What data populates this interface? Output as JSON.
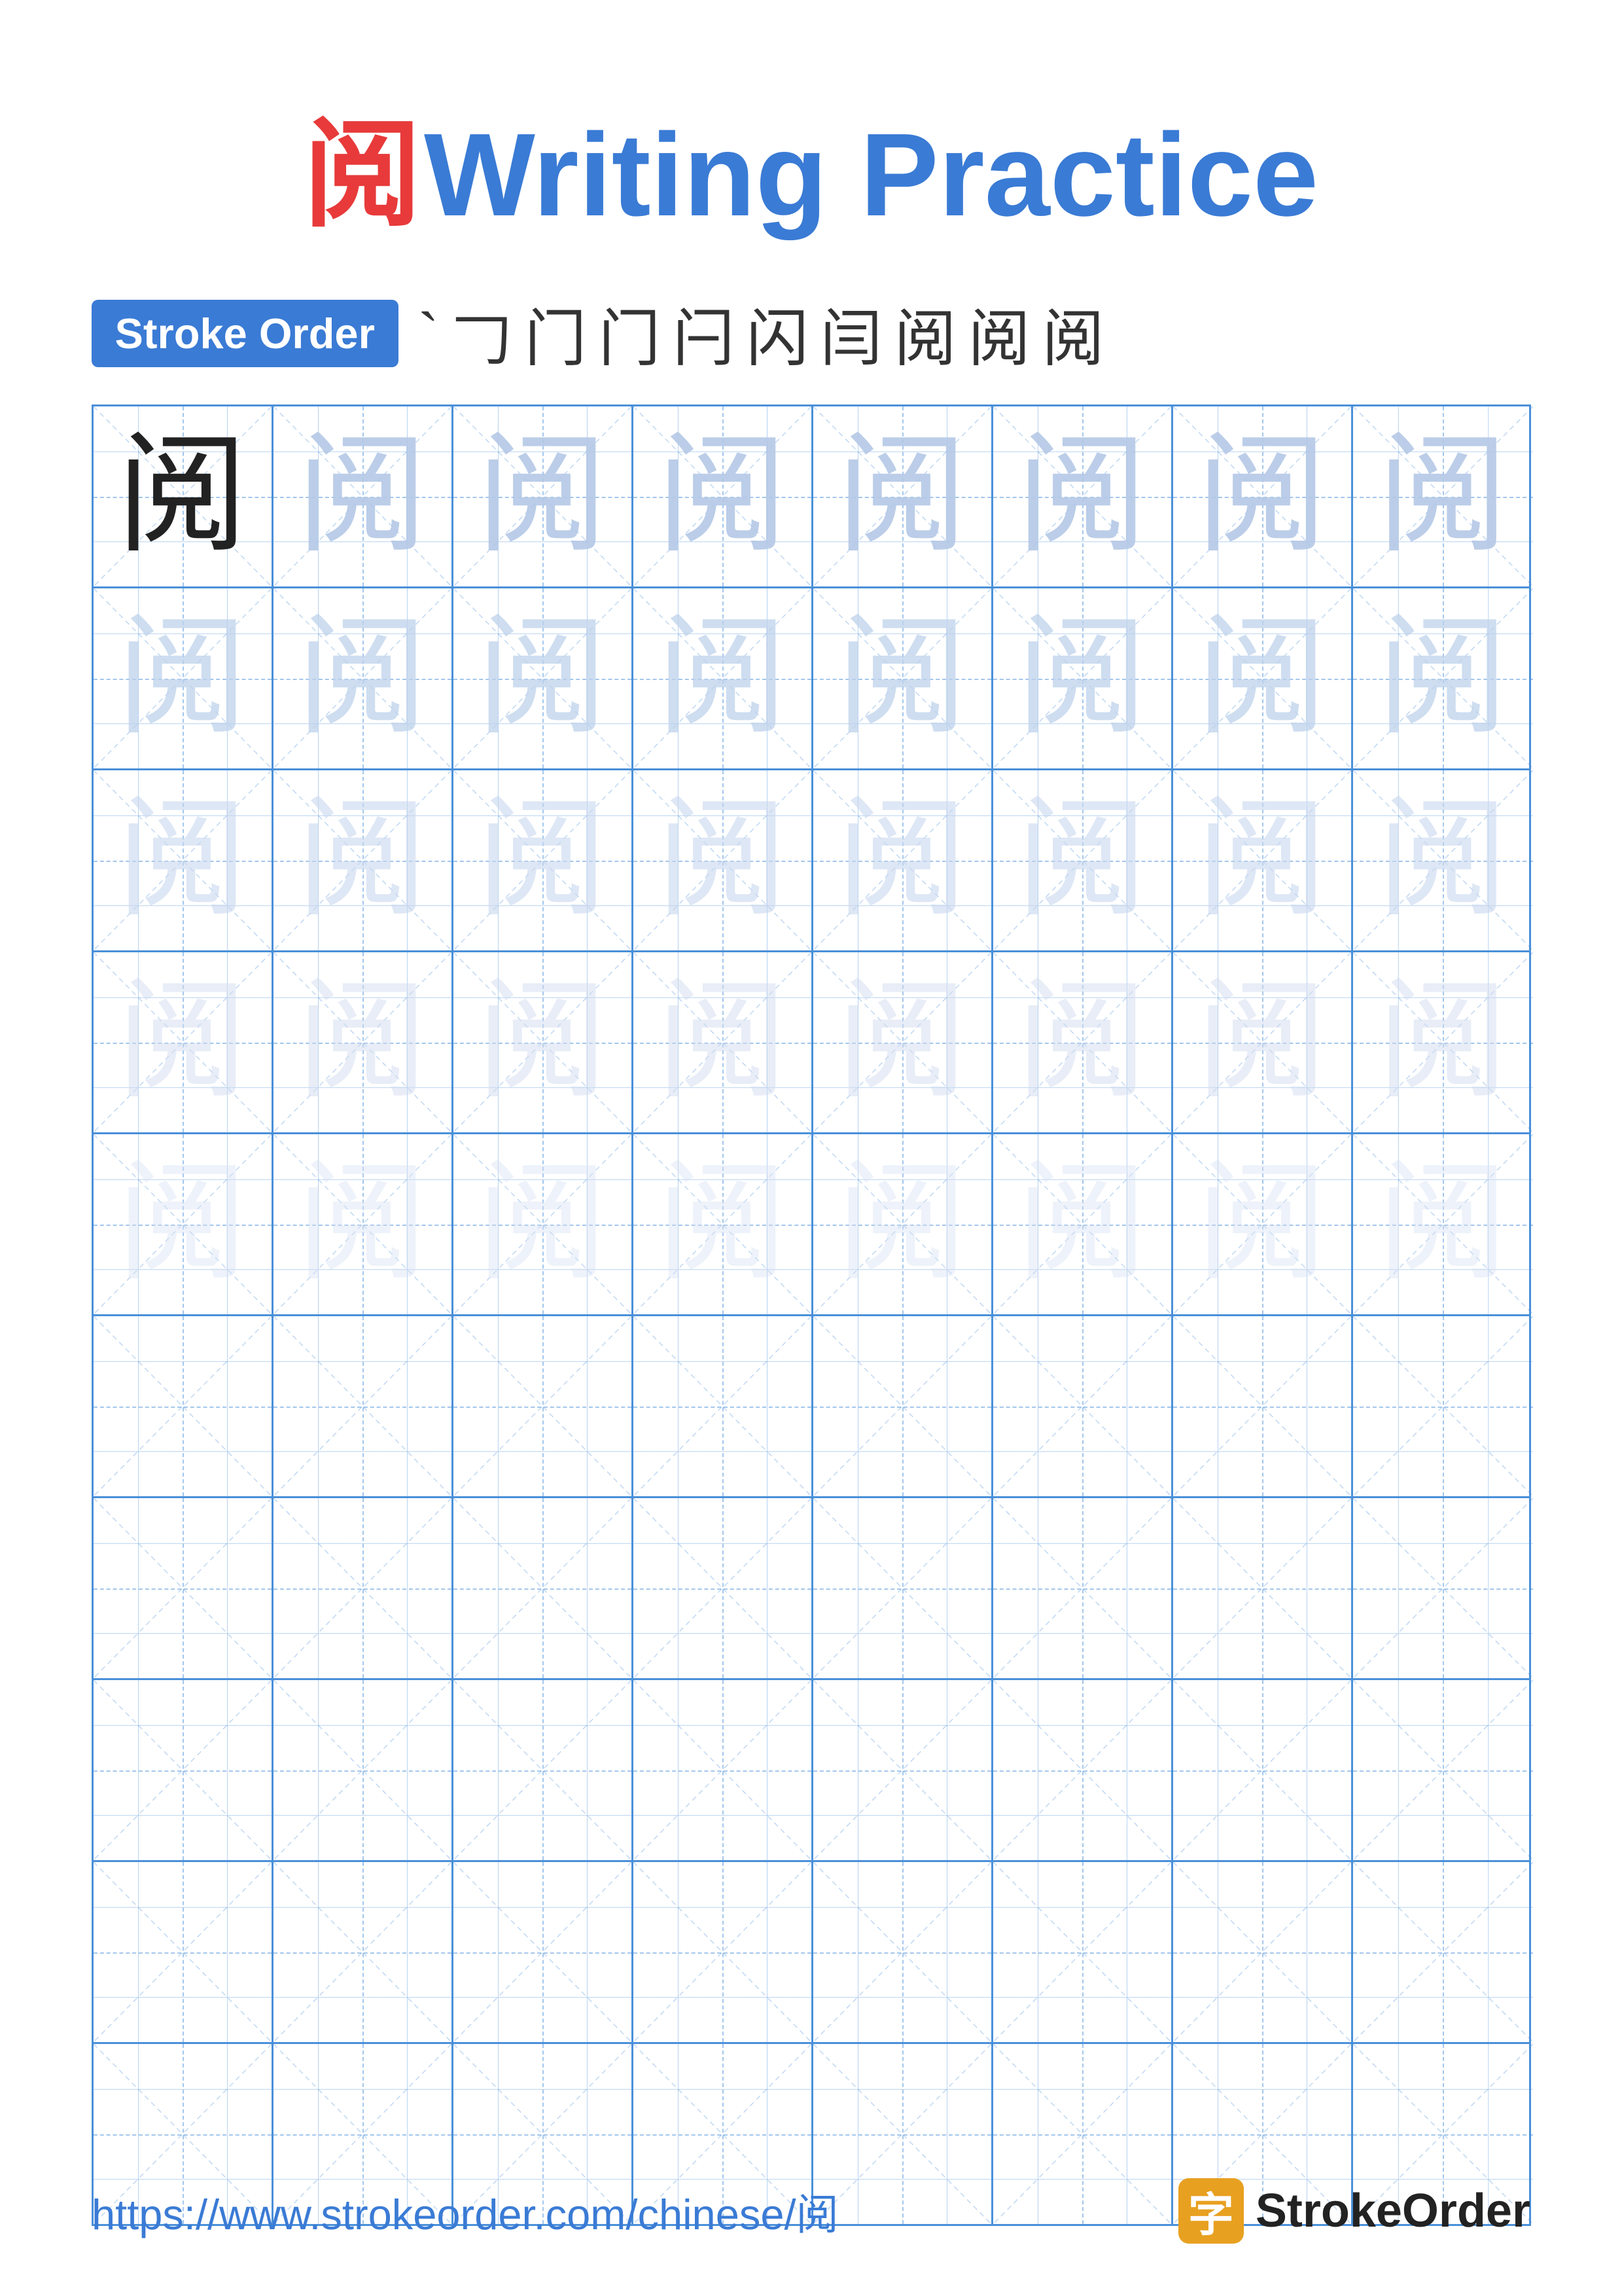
{
  "title": {
    "char": "阅",
    "text": "Writing Practice"
  },
  "stroke_order": {
    "badge_label": "Stroke Order",
    "strokes": [
      "`",
      "𠃌",
      "门",
      "门",
      "闩",
      "闪",
      "闫",
      "阅",
      "阅",
      "阅"
    ]
  },
  "grid": {
    "rows": 10,
    "cols": 8,
    "character": "阅",
    "ghost_rows": 5
  },
  "footer": {
    "url": "https://www.strokeorder.com/chinese/阅",
    "logo_char": "字",
    "logo_text": "StrokeOrder"
  }
}
